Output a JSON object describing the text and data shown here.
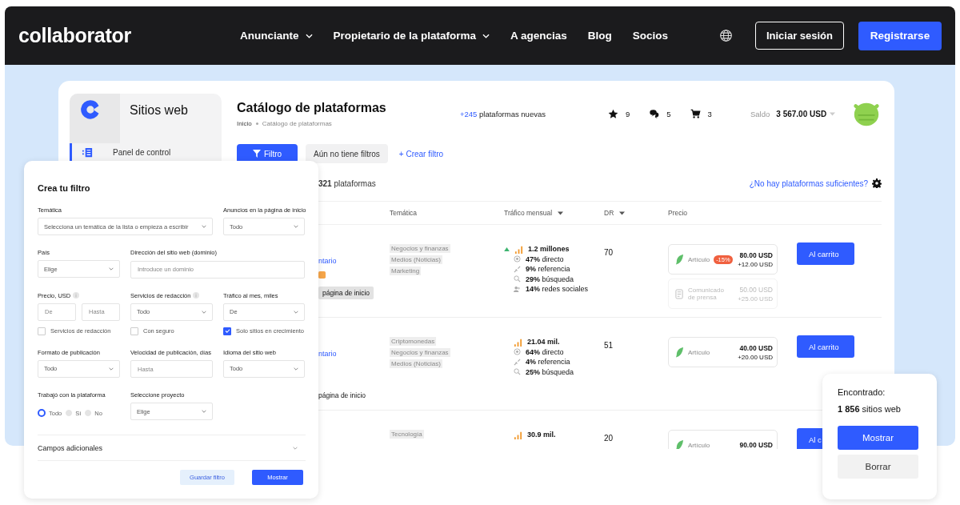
{
  "nav": {
    "logo": "collaborator",
    "items": [
      {
        "label": "Anunciante",
        "dropdown": true
      },
      {
        "label": "Propietario de la plataforma",
        "dropdown": true
      },
      {
        "label": "A agencias",
        "dropdown": false
      },
      {
        "label": "Blog",
        "dropdown": false
      },
      {
        "label": "Socios",
        "dropdown": false
      }
    ],
    "login": "Iniciar sesión",
    "register": "Registrarse"
  },
  "sidebar": {
    "title": "Sitios web",
    "items": [
      {
        "label": "Panel de control",
        "selected": true
      }
    ]
  },
  "header": {
    "title": "Catálogo de plataformas",
    "breadcrumb": [
      "Inicio",
      "Catálogo de plataformas"
    ],
    "new_count": "+245",
    "new_label": "plataformas nuevas",
    "counters": [
      {
        "kind": "favorites",
        "value": "9"
      },
      {
        "kind": "messages",
        "value": "5"
      },
      {
        "kind": "cart",
        "value": "3"
      }
    ],
    "balance_label": "Saldo",
    "balance": "3 567.00 USD"
  },
  "toolbar": {
    "filter_button": "Filtro",
    "saved_filters": "Aún no tiene filtros",
    "create_filter": "+ Crear filtro"
  },
  "results": {
    "count": "**321** plataformas",
    "link": "¿No hay plataformas suficientes?"
  },
  "table": {
    "columns": [
      {
        "label": "Temática",
        "sortable": false
      },
      {
        "label": "Tráfico mensual",
        "sortable": true
      },
      {
        "label": "DR",
        "sortable": true
      },
      {
        "label": "Precio",
        "sortable": false
      }
    ],
    "rows": [
      {
        "name": "ntario",
        "badge": true,
        "home_tag": "página de inicio",
        "home_tag_highlighted": true,
        "topics": [
          "Negocios y finanzas",
          "Medios (Noticias)",
          "Marketing"
        ],
        "traffic": "1.2 millones",
        "trend_up": true,
        "sources": [
          {
            "kind": "direct",
            "text": "**47%** directo"
          },
          {
            "kind": "referral",
            "text": "**9%** referencia"
          },
          {
            "kind": "search",
            "text": "**29%** búsqueda"
          },
          {
            "kind": "social",
            "text": "**14%** redes sociales"
          }
        ],
        "dr": "70",
        "offers": [
          {
            "kind": "article",
            "label": "Artículo",
            "discount": "-15%",
            "price": "80.00 USD",
            "extra": "+12.00 USD",
            "disabled": false
          },
          {
            "kind": "press",
            "label": "Comunicado de prensa",
            "price": "50.00 USD",
            "extra": "+25.00 USD",
            "disabled": true
          }
        ],
        "button": "Al carrito"
      },
      {
        "name": "ntario",
        "badge": false,
        "home_tag": "página de inicio",
        "home_tag_highlighted": false,
        "topics": [
          "Criptomonedas",
          "Negocios y finanzas",
          "Medios (Noticias)"
        ],
        "traffic": "21.04 mil.",
        "trend_up": false,
        "sources": [
          {
            "kind": "direct",
            "text": "**64%** directo"
          },
          {
            "kind": "referral",
            "text": "**4%** referencia"
          },
          {
            "kind": "search",
            "text": "**25%** búsqueda"
          }
        ],
        "dr": "51",
        "offers": [
          {
            "kind": "article",
            "label": "Artículo",
            "price": "40.00 USD",
            "extra": "+20.00 USD",
            "disabled": false
          }
        ],
        "button": "Al carrito"
      },
      {
        "topics": [
          "Tecnología"
        ],
        "traffic": "30.9 mil.",
        "trend_up": false,
        "sources": [],
        "dr": "20",
        "offers": [
          {
            "kind": "article",
            "label": "Artículo",
            "price": "90.00 USD",
            "disabled": false
          }
        ],
        "button": "Al c"
      }
    ]
  },
  "filter": {
    "title": "Crea tu filtro",
    "fields": [
      {
        "kind": "select",
        "label": "Temática",
        "value": "Selecciona un temática de la lista o empieza a escribir"
      },
      {
        "kind": "select",
        "label": "Anuncios en la página de inicio",
        "value": "Todo"
      },
      {
        "kind": "select",
        "label": "País",
        "value": "Elige"
      },
      {
        "kind": "input",
        "label": "Dirección del sitio web (dominio)",
        "placeholder": "Introduce un dominio"
      },
      {
        "kind": "range",
        "label": "Precio, USD",
        "info": true,
        "from_placeholder": "De",
        "to_placeholder": "Hasta"
      },
      {
        "kind": "select",
        "label": "Servicios de redacción",
        "info": true,
        "value": "Todo"
      },
      {
        "kind": "select",
        "label": "Tráfico al mes, miles",
        "value": "De"
      },
      {
        "kind": "checkbox",
        "label": "Servicios de redacción",
        "checked": false
      },
      {
        "kind": "checkbox",
        "label": "Con seguro",
        "checked": false
      },
      {
        "kind": "checkbox",
        "label": "Solo sitios en crecimiento",
        "checked": true
      },
      {
        "kind": "select",
        "label": "Formato de publicación",
        "value": "Todo"
      },
      {
        "kind": "input",
        "label": "Velocidad de publicación, días",
        "placeholder": "Hasta"
      },
      {
        "kind": "select",
        "label": "Idioma del sitio web",
        "value": "Todo"
      },
      {
        "kind": "radio",
        "label": "Trabajó con la plataforma",
        "options": [
          {
            "label": "Todo",
            "selected": true
          },
          {
            "label": "Sí",
            "selected": false
          },
          {
            "label": "No",
            "selected": false
          }
        ]
      },
      {
        "kind": "select",
        "label": "Seleccione proyecto",
        "value": "Elige"
      }
    ],
    "more": "Campos adicionales",
    "save": "Guardar filtro",
    "apply": "Mostrar"
  },
  "found": {
    "label": "Encontrado:",
    "count": "**1 856** sitios web",
    "show": "Mostrar",
    "clear": "Borrar"
  }
}
